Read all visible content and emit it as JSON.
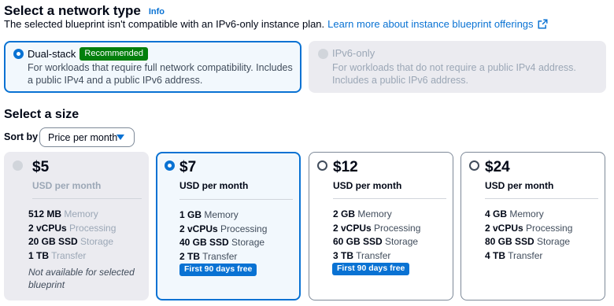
{
  "network": {
    "title": "Select a network type",
    "info_link": "Info",
    "description": "The selected blueprint isn't compatible with an IPv6-only instance plan.",
    "learn_more": "Learn more about instance blueprint offerings",
    "options": [
      {
        "label": "Dual-stack",
        "badge": "Recommended",
        "description": "For workloads that require full network compatibility. Includes a public IPv4 and a public IPv6 address.",
        "state": "selected"
      },
      {
        "label": "IPv6-only",
        "description": "For workloads that do not require a public IPv4 address. Includes a public IPv6 address.",
        "state": "disabled"
      }
    ]
  },
  "size": {
    "title": "Select a size",
    "sort_label": "Sort by",
    "sort_value": "Price per month",
    "plans": [
      {
        "price": "$5",
        "period": "USD per month",
        "state": "disabled",
        "memory": "512 MB",
        "memory_label": "Memory",
        "processing": "2 vCPUs",
        "processing_label": "Processing",
        "storage": "20 GB SSD",
        "storage_label": "Storage",
        "transfer": "1 TB",
        "transfer_label": "Transfer",
        "note": "Not available for selected blueprint"
      },
      {
        "price": "$7",
        "period": "USD per month",
        "state": "selected",
        "memory": "1 GB",
        "memory_label": "Memory",
        "processing": "2 vCPUs",
        "processing_label": "Processing",
        "storage": "40 GB SSD",
        "storage_label": "Storage",
        "transfer": "2 TB",
        "transfer_label": "Transfer",
        "promo": "First 90 days free"
      },
      {
        "price": "$12",
        "period": "USD per month",
        "state": "unselected",
        "memory": "2 GB",
        "memory_label": "Memory",
        "processing": "2 vCPUs",
        "processing_label": "Processing",
        "storage": "60 GB SSD",
        "storage_label": "Storage",
        "transfer": "3 TB",
        "transfer_label": "Transfer",
        "promo": "First 90 days free"
      },
      {
        "price": "$24",
        "period": "USD per month",
        "state": "unselected",
        "memory": "4 GB",
        "memory_label": "Memory",
        "processing": "2 vCPUs",
        "processing_label": "Processing",
        "storage": "80 GB SSD",
        "storage_label": "Storage",
        "transfer": "4 TB",
        "transfer_label": "Transfer"
      }
    ]
  },
  "icons": {
    "external_link": "external-link-icon",
    "caret": "caret-down-icon"
  },
  "colors": {
    "accent": "#0972d3",
    "recommended": "#037f0c",
    "disabled_bg": "#ebebf0",
    "selected_bg": "#f2f8fd"
  }
}
